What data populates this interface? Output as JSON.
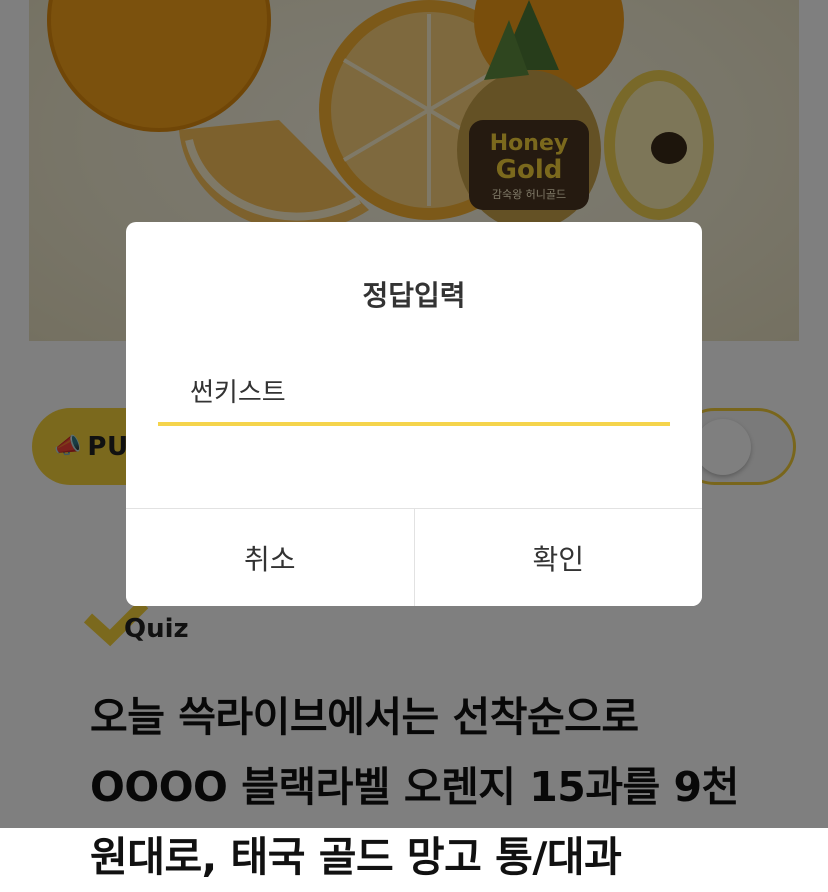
{
  "hero": {
    "product_brand_line1": "Honey",
    "product_brand_line2": "Gold",
    "product_sub": "감숙왕 허니골드"
  },
  "push": {
    "icon": "megaphone-icon",
    "label": "PUS"
  },
  "quiz": {
    "label": "Quiz"
  },
  "question": {
    "text": "오늘 쓱라이브에서는 선착순으로 OOOO 블랙라벨 오렌지 15과를 9천 원대로, 태국 골드 망고 통/대과"
  },
  "dialog": {
    "title": "정답입력",
    "input_value": "썬키스트",
    "cancel_label": "취소",
    "confirm_label": "확인"
  },
  "colors": {
    "accent_yellow": "#f7d23a",
    "input_underline": "#f5d44c",
    "overlay": "rgba(0,0,0,0.5)"
  }
}
